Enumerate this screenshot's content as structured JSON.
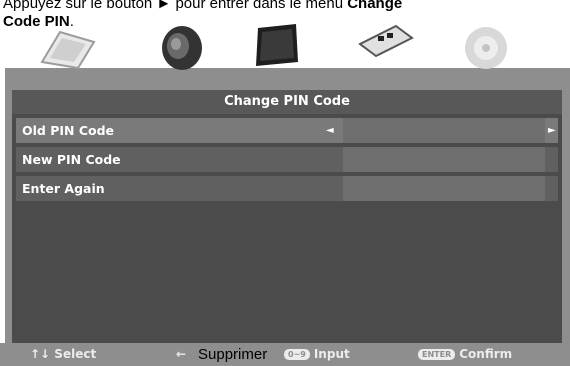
{
  "caption": {
    "line1_prefix": "Appuyez sur le bouton ► pour entrer dans le menu ",
    "line1_bold": "Change",
    "line2_bold": "Code PIN",
    "line2_suffix": "."
  },
  "menu_icons": [
    "picture-icon",
    "audio-speaker-icon",
    "tv-screen-icon",
    "remote-icon",
    "disc-icon"
  ],
  "panel": {
    "title": "Change PIN Code",
    "rows": [
      {
        "label": "Old PIN Code",
        "left_arrow": "◄",
        "right_arrow": "►"
      },
      {
        "label": "New PIN Code"
      },
      {
        "label": "Enter Again"
      }
    ]
  },
  "footer": {
    "select_arrows": "↑↓",
    "select_label": "Select",
    "back_arrow": "←",
    "input_badge": "0~9",
    "input_label": "Input",
    "confirm_badge": "ENTER",
    "confirm_label": "Confirm"
  },
  "overlay_text": "Supprimer",
  "colors": {
    "osd_background": "#8e8e8e",
    "panel_background": "#4b4b4b",
    "row_background": "#606060",
    "field_background": "#6e6e6e"
  }
}
